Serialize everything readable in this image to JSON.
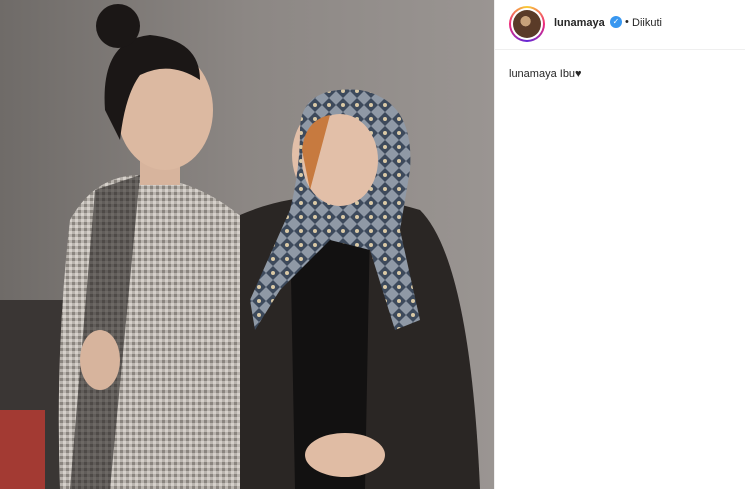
{
  "post": {
    "username": "lunamaya",
    "verified_icon": "verified-badge-icon",
    "separator": "•",
    "follow_status": "Diikuti",
    "caption_user": "lunamaya",
    "caption_text": " Ibu♥",
    "photo_icon": "post-photo"
  },
  "colors": {
    "verified": "#3897f0",
    "photo_background": "#7b7672"
  }
}
